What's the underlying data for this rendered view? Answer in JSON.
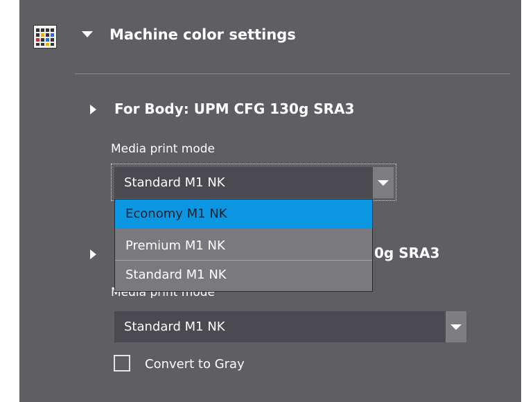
{
  "section": {
    "title": "Machine color settings",
    "icon": "color-chart-icon"
  },
  "body_group": {
    "title": "For Body: UPM CFG 130g SRA3",
    "media_print_mode_label": "Media print mode",
    "selected_value": "Standard M1 NK"
  },
  "second_group": {
    "title_visible_fragment": "0g SRA3",
    "media_print_mode_label": "Media print mode",
    "selected_value": "Standard M1 NK"
  },
  "dropdown": {
    "options": [
      "Economy M1 NK",
      "Premium M1 NK",
      "Standard M1 NK"
    ],
    "highlighted_index": 0
  },
  "convert_to_gray": {
    "label": "Convert to Gray",
    "checked": false
  },
  "colors": {
    "panel_bg": "#5f5f63",
    "select_bg": "#4a4a50",
    "highlight": "#0c96e1"
  }
}
